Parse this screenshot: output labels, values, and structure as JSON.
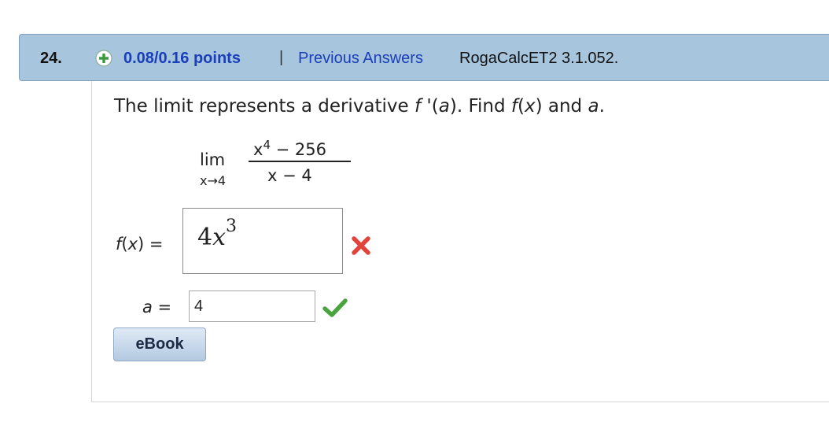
{
  "header": {
    "question_number": "24.",
    "points": "0.08/0.16 points",
    "separator": "|",
    "previous_answers": "Previous Answers",
    "reference": "RogaCalcET2 3.1.052."
  },
  "question": {
    "prompt": {
      "part1": "The limit represents a derivative ",
      "f": "f",
      "prime": " '(",
      "a1": "a",
      "part2": "). Find ",
      "f2": "f",
      "part3": "(",
      "x": "x",
      "part4": ") and ",
      "a2": "a",
      "part5": "."
    },
    "limit": {
      "lim": "lim",
      "subscript": "x→4",
      "numerator_base": "x",
      "numerator_exp": "4",
      "numerator_rest": " − 256",
      "denominator": "x − 4"
    }
  },
  "answers": {
    "fx_label": {
      "f": "f",
      "open": "(",
      "x": "x",
      "close": ") ="
    },
    "fx_value": {
      "coef": "4",
      "var": "x",
      "exp": "3"
    },
    "fx_status": "incorrect",
    "a_label": {
      "a": "a",
      "eq": " ="
    },
    "a_value": "4",
    "a_status": "correct"
  },
  "buttons": {
    "ebook": "eBook"
  },
  "colors": {
    "header_bg": "#a7c6de",
    "link": "#1a3fb8",
    "incorrect": "#e0443c",
    "correct": "#4aa43e"
  }
}
